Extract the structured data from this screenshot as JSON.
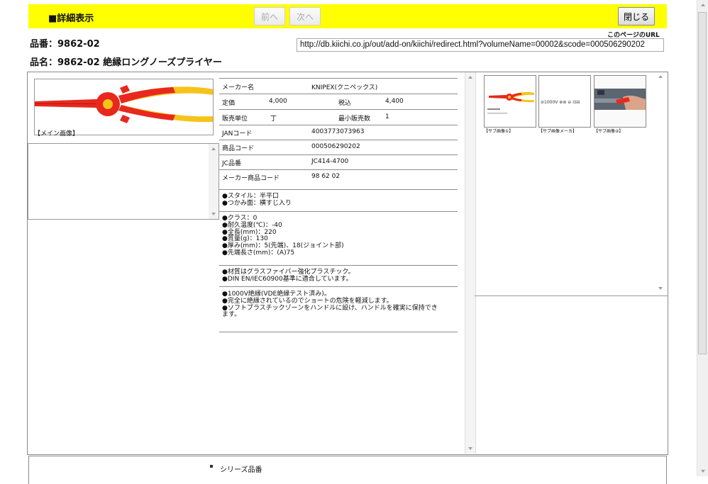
{
  "header": {
    "title": "■詳細表示",
    "prev_label": "前へ",
    "next_label": "次へ",
    "close_label": "閉じる"
  },
  "product": {
    "number_line": "品番：9862-02",
    "name_line": "品名：9862-02 絶縁ロングノーズプライヤー"
  },
  "page_url": {
    "label": "このページのURL",
    "value": "http://db.kiichi.co.jp/out/add-on/kiichi/redirect.html?volumeName=00002&scode=000506290202"
  },
  "main_image": {
    "caption": "【メイン画像】"
  },
  "specs": {
    "maker_label": "メーカー名",
    "maker_value": "KNIPEX(クニペックス)",
    "price_label": "定価",
    "price_value": "4,000",
    "tax_label": "税込",
    "tax_value": "4,400",
    "unit_label": "販売単位",
    "unit_value": "丁",
    "min_label": "最小販売数",
    "min_value": "1",
    "jan_label": "JANコード",
    "jan_value": "4003773073963",
    "code_label": "商品コード",
    "code_value": "000506290202",
    "jc_label": "JC品番",
    "jc_value": "JC414-4700",
    "maker_code_label": "メーカー商品コード",
    "maker_code_value": "98 62 02"
  },
  "notes": {
    "block1": "●スタイル：半平口\n●つかみ面：横すじ入り",
    "block2": "●クラス：0\n●耐久温度(℃)：-40\n●全長(mm)：220\n●質量(g)：130\n●厚み(mm)：5(先端)、18(ジョイント部)\n●先端長さ(mm)：(A)75",
    "block3": "●材質はグラスファイバー強化プラスチック。\n●DIN EN/IEC60900基準に適合しています。",
    "block4": "●1000V絶縁(VDE絶縁テスト済み)。\n●完全に絶縁されているのでショートの危険を軽減します。\n●ソフトプラスチックゾーンをハンドルに設け、ハンドルを確実に保持でき\nます。"
  },
  "thumbnails": [
    {
      "caption": "【サブ画像①】"
    },
    {
      "caption": "【サブ画像メーカ】"
    },
    {
      "caption": "【サブ画像②】"
    }
  ],
  "thumb2_text": "⊘1000V  ⊛⊛  ⊖  ⊡⊟",
  "series": {
    "label": "シリーズ品番"
  },
  "colors": {
    "header_bg": "#ffff00",
    "plier_red": "#e8281e",
    "plier_yellow": "#f6c31a"
  }
}
